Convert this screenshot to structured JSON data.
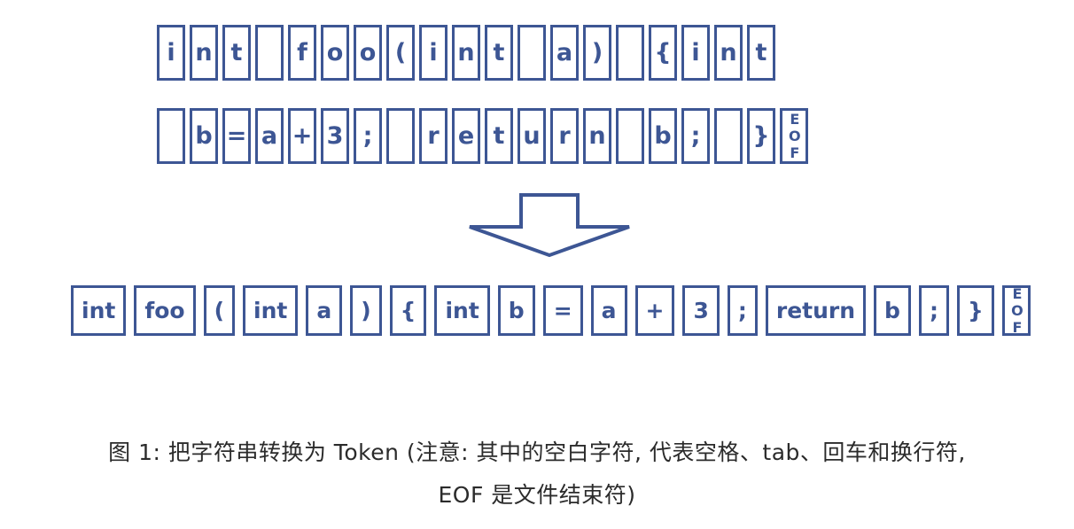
{
  "figure": {
    "label": "图 1",
    "accent_color": "#3d5694",
    "caption_color": "#2b2b2b",
    "background_color": "#ffffff"
  },
  "char_rows": [
    {
      "name": "char-row-1",
      "cells": [
        {
          "text": "i",
          "blank": false
        },
        {
          "text": "n",
          "blank": false
        },
        {
          "text": "t",
          "blank": false
        },
        {
          "text": " ",
          "blank": true
        },
        {
          "text": "f",
          "blank": false
        },
        {
          "text": "o",
          "blank": false
        },
        {
          "text": "o",
          "blank": false
        },
        {
          "text": "(",
          "blank": false
        },
        {
          "text": "i",
          "blank": false
        },
        {
          "text": "n",
          "blank": false
        },
        {
          "text": "t",
          "blank": false
        },
        {
          "text": " ",
          "blank": true
        },
        {
          "text": "a",
          "blank": false
        },
        {
          "text": ")",
          "blank": false
        },
        {
          "text": " ",
          "blank": true
        },
        {
          "text": "{",
          "blank": false
        },
        {
          "text": "i",
          "blank": false
        },
        {
          "text": "n",
          "blank": false
        },
        {
          "text": "t",
          "blank": false
        }
      ]
    },
    {
      "name": "char-row-2",
      "cells": [
        {
          "text": " ",
          "blank": true
        },
        {
          "text": "b",
          "blank": false
        },
        {
          "text": "=",
          "blank": false
        },
        {
          "text": "a",
          "blank": false
        },
        {
          "text": "+",
          "blank": false
        },
        {
          "text": "3",
          "blank": false
        },
        {
          "text": ";",
          "blank": false
        },
        {
          "text": " ",
          "blank": true
        },
        {
          "text": "r",
          "blank": false
        },
        {
          "text": "e",
          "blank": false
        },
        {
          "text": "t",
          "blank": false
        },
        {
          "text": "u",
          "blank": false
        },
        {
          "text": "r",
          "blank": false
        },
        {
          "text": "n",
          "blank": false
        },
        {
          "text": " ",
          "blank": true
        },
        {
          "text": "b",
          "blank": false
        },
        {
          "text": ";",
          "blank": false
        },
        {
          "text": " ",
          "blank": true
        },
        {
          "text": "}",
          "blank": false
        },
        {
          "text": "EOF",
          "blank": false,
          "eof": true
        }
      ]
    }
  ],
  "arrow": {
    "direction": "down",
    "icon": "arrow-down-icon",
    "color": "#3d5694"
  },
  "tokens": [
    {
      "text": "int"
    },
    {
      "text": "foo"
    },
    {
      "text": "("
    },
    {
      "text": "int"
    },
    {
      "text": "a"
    },
    {
      "text": ")"
    },
    {
      "text": "{"
    },
    {
      "text": "int"
    },
    {
      "text": "b"
    },
    {
      "text": "="
    },
    {
      "text": "a"
    },
    {
      "text": "+"
    },
    {
      "text": "3"
    },
    {
      "text": ";"
    },
    {
      "text": "return"
    },
    {
      "text": "b"
    },
    {
      "text": ";"
    },
    {
      "text": "}"
    },
    {
      "text": "EOF",
      "eof": true
    }
  ],
  "caption": {
    "line1": "图 1: 把字符串转换为 Token (注意: 其中的空白字符, 代表空格、tab、回车和换行符,",
    "line2": "EOF 是文件结束符)"
  }
}
